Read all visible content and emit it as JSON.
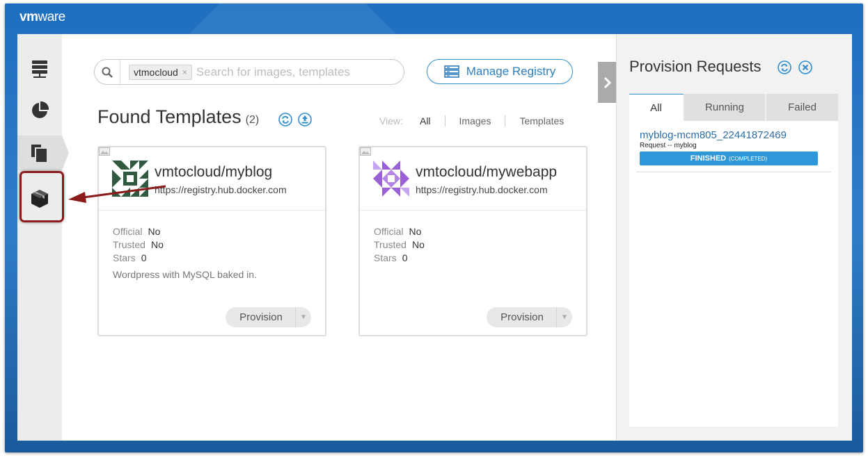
{
  "brand": {
    "vm": "vm",
    "ware": "ware"
  },
  "nav": {
    "items": [
      {
        "name": "hosts",
        "icon": "server-stack-icon"
      },
      {
        "name": "dashboard",
        "icon": "pie-chart-icon"
      },
      {
        "name": "templates",
        "icon": "documents-icon",
        "active": true
      },
      {
        "name": "containers",
        "icon": "cube-box-icon"
      }
    ]
  },
  "search": {
    "tag": "vtmocloud",
    "tag_close": "×",
    "placeholder": "Search for images, templates"
  },
  "manage_registry": {
    "label": "Manage Registry"
  },
  "found": {
    "title": "Found Templates",
    "count": "(2)"
  },
  "view": {
    "label": "View:",
    "options": [
      "All",
      "Images",
      "Templates"
    ],
    "selected": "All"
  },
  "cards": [
    {
      "name": "vmtocloud/myblog",
      "url": "https://registry.hub.docker.com",
      "props": [
        {
          "key": "Official",
          "value": "No"
        },
        {
          "key": "Trusted",
          "value": "No"
        },
        {
          "key": "Stars",
          "value": "0"
        }
      ],
      "description": "Wordpress with MySQL baked in.",
      "provision": "Provision",
      "avatar_color": "#2f5a3f"
    },
    {
      "name": "vmtocloud/mywebapp",
      "url": "https://registry.hub.docker.com",
      "props": [
        {
          "key": "Official",
          "value": "No"
        },
        {
          "key": "Trusted",
          "value": "No"
        },
        {
          "key": "Stars",
          "value": "0"
        }
      ],
      "description": "",
      "provision": "Provision",
      "avatar_color": "#9b5fd6"
    }
  ],
  "panel": {
    "title": "Provision Requests",
    "tabs": [
      {
        "label": "All",
        "active": true
      },
      {
        "label": "Running"
      },
      {
        "label": "Failed"
      }
    ],
    "request": {
      "name": "myblog-mcm805_22441872469",
      "subtitle": "Request -- myblog",
      "status": "FINISHED",
      "status_detail": "(COMPLETED)"
    }
  },
  "colors": {
    "accent": "#2d8fd0",
    "frame_blue": "#2f7dc8",
    "annotation_red": "#8b1a1a",
    "status_blue": "#2d97d9"
  }
}
